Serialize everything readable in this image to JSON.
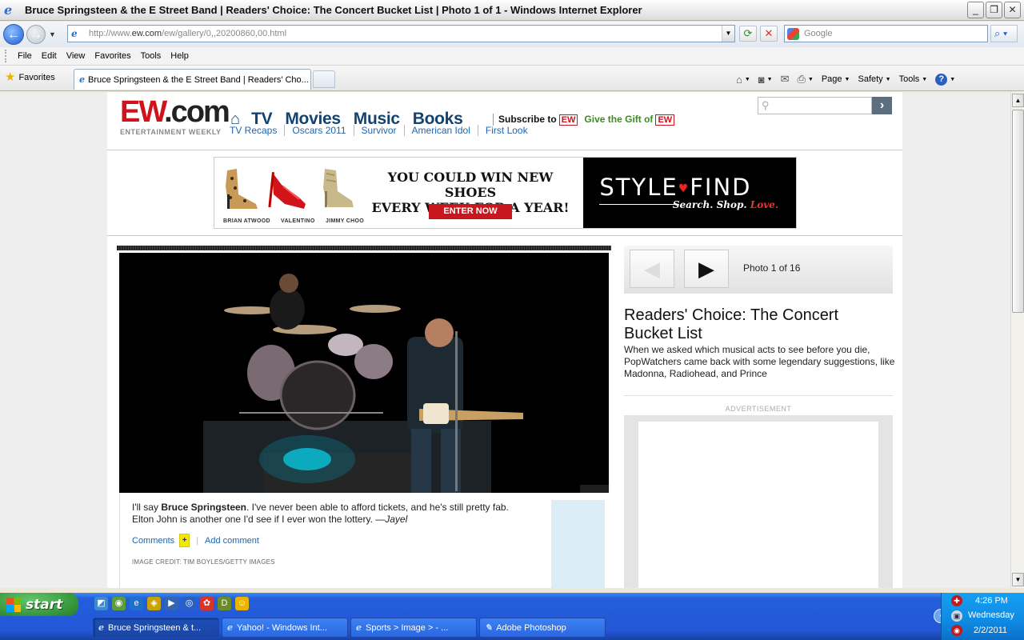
{
  "window": {
    "title": "Bruce Springsteen & the E Street Band | Readers' Choice: The Concert Bucket List | Photo 1 of 1 - Windows Internet Explorer"
  },
  "address_bar": {
    "url_prefix": "http://www.",
    "url_domain": "ew.com",
    "url_path": "/ew/gallery/0,,20200860,00.html",
    "search_placeholder": "Google"
  },
  "menu": {
    "items": [
      "File",
      "Edit",
      "View",
      "Favorites",
      "Tools",
      "Help"
    ]
  },
  "tabs_bar": {
    "favorites_label": "Favorites",
    "active_tab": "Bruce Springsteen & the E Street Band | Readers' Cho...",
    "commands": {
      "page": "Page",
      "safety": "Safety",
      "tools": "Tools"
    }
  },
  "site": {
    "logo_main": "EW",
    "logo_suffix": ".com",
    "logo_sub": "ENTERTAINMENT WEEKLY",
    "nav": [
      "TV",
      "Movies",
      "Music",
      "Books"
    ],
    "subscribe_label": "Subscribe to",
    "gift_label": "Give the Gift of",
    "ew_badge": "EW",
    "subnav": [
      "TV Recaps",
      "Oscars 2011",
      "Survivor",
      "American Idol",
      "First Look"
    ]
  },
  "banner_ad": {
    "brands": [
      "BRIAN ATWOOD",
      "VALENTINO",
      "JIMMY CHOO"
    ],
    "headline_line1": "YOU COULD WIN NEW SHOES",
    "headline_line2": "EVERY WEEK FOR A YEAR!",
    "cta": "ENTER NOW",
    "logo_left": "STYLE",
    "logo_right": "FIND",
    "tagline": "Search. Shop.",
    "tagline_love": "Love."
  },
  "gallery": {
    "photo_count": "Photo 1 of 16",
    "title": "Readers' Choice: The Concert Bucket List",
    "description": "When we asked which musical acts to see before you die, PopWatchers came back with some legendary suggestions, like Madonna, Radiohead, and Prince",
    "advertisement_label": "ADVERTISEMENT"
  },
  "caption": {
    "pre": "I'll say ",
    "bold": "Bruce Springsteen",
    "post": ". I've never been able to afford tickets, and he's still pretty fab. Elton John is another one I'd see if I ever won the lottery. —",
    "author": "Jayel",
    "comments_label": "Comments",
    "plus": "+",
    "add_comment": "Add comment",
    "credit": "IMAGE CREDIT: TIM BOYLES/GETTY IMAGES"
  },
  "taskbar": {
    "start_label": "start",
    "tasks": [
      "Bruce Springsteen & t...",
      "Yahoo! - Windows Int...",
      "Sports > Image > - ...",
      "Adobe Photoshop"
    ],
    "time": "4:26 PM",
    "day": "Wednesday",
    "date": "2/2/2011"
  },
  "colors": {
    "ew_red": "#d0121b",
    "nav_blue": "#14436f",
    "link_blue": "#1d66b0",
    "gift_green": "#3c8b1f",
    "xp_blue": "#245edb"
  }
}
